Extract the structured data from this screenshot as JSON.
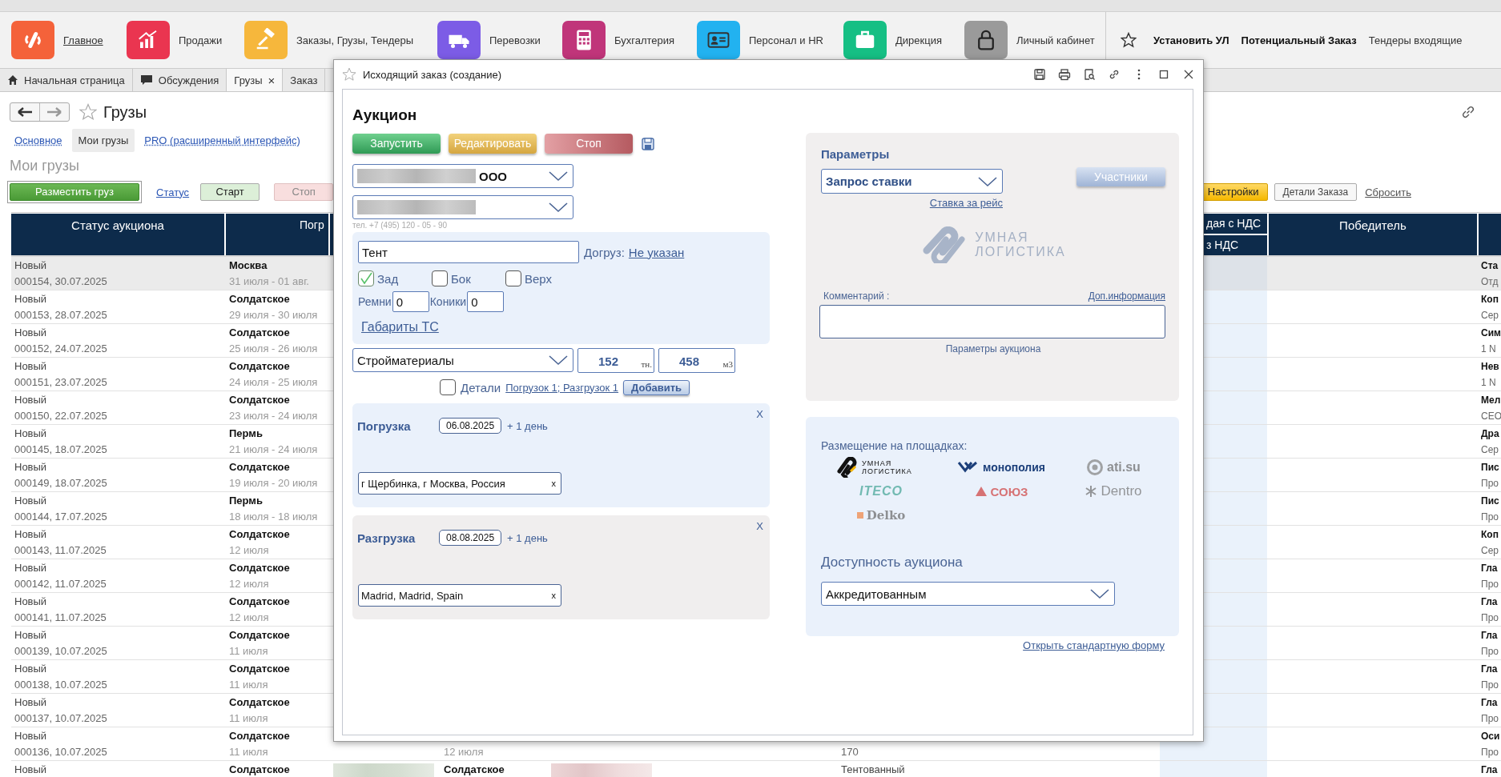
{
  "nav": {
    "items": [
      {
        "label": "Главное",
        "color": "#f4623a",
        "selected": true
      },
      {
        "label": "Продажи",
        "color": "#ea3550",
        "selected": false
      },
      {
        "label": "Заказы, Грузы, Тендеры",
        "color": "#f6b73c",
        "selected": false
      },
      {
        "label": "Перевозки",
        "color": "#7c5ce6",
        "selected": false
      },
      {
        "label": "Бухгалтерия",
        "color": "#c0357a",
        "selected": false
      },
      {
        "label": "Персонал и HR",
        "color": "#22b2f0",
        "selected": false
      },
      {
        "label": "Дирекция",
        "color": "#16bf84",
        "selected": false
      },
      {
        "label": "Личный кабинет",
        "color": "#9a9a9a",
        "selected": false
      }
    ],
    "links": [
      {
        "label": "Установить УЛ",
        "bold": true
      },
      {
        "label": "Потенциальный Заказ",
        "bold": true
      },
      {
        "label": "Тендеры входящие",
        "bold": false
      }
    ]
  },
  "tabs": [
    {
      "label": "Начальная страница",
      "selected": false
    },
    {
      "label": "Обсуждения",
      "selected": false
    },
    {
      "label": "Грузы",
      "selected": true,
      "close": "×"
    },
    {
      "label": "Заказ",
      "selected": false
    }
  ],
  "page": {
    "title": "Грузы",
    "subtabs": [
      {
        "label": "Основное",
        "selected": false
      },
      {
        "label": "Мои грузы",
        "selected": true
      },
      {
        "label": "PRO (расширенный интерфейс)",
        "selected": false
      }
    ],
    "heading": "Мои грузы",
    "toolbar": [
      {
        "kind": "primary",
        "label": "Разместить груз"
      },
      {
        "kind": "link",
        "label": "Статус"
      },
      {
        "kind": "start",
        "label": "Старт"
      },
      {
        "kind": "stop",
        "label": "Стоп"
      }
    ],
    "toolbar_right": [
      {
        "kind": "settings",
        "label": "Настройки"
      },
      {
        "kind": "plain",
        "label": "Детали Заказа"
      },
      {
        "kind": "link",
        "label": "Сбросить"
      }
    ]
  },
  "table": {
    "headers": {
      "status": "Статус аукциона",
      "loading": "Погр",
      "price": "дая с НДС",
      "price_sub": "з НДС",
      "winner": "Победитель"
    },
    "rows": [
      {
        "selected": true,
        "status": "Новый",
        "number": "000154, 30.07.2025",
        "loading": "Москва",
        "loading_dates": "31 июля - 01 авг.",
        "column_9": {
          "line_1": "Ста",
          "line_2": "Отд"
        }
      },
      {
        "selected": false,
        "status": "Новый",
        "number": "000153, 28.07.2025",
        "loading": "Солдатское",
        "loading_dates": "29 июля - 30 июля",
        "column_9": {
          "line_1": "Коп",
          "line_2": "Сер"
        }
      },
      {
        "selected": false,
        "status": "Новый",
        "number": "000152, 24.07.2025",
        "loading": "Солдатское",
        "loading_dates": "25 июля - 26 июля",
        "column_9": {
          "line_1": "Сим",
          "line_2": "1 N"
        }
      },
      {
        "selected": false,
        "status": "Новый",
        "number": "000151, 23.07.2025",
        "loading": "Солдатское",
        "loading_dates": "24 июля - 25 июля",
        "column_9": {
          "line_1": "Нев",
          "line_2": "1 N"
        }
      },
      {
        "selected": false,
        "status": "Новый",
        "number": "000150, 22.07.2025",
        "loading": "Солдатское",
        "loading_dates": "23 июля - 24 июля",
        "column_9": {
          "line_1": "Мел",
          "line_2": "CEO"
        }
      },
      {
        "selected": false,
        "status": "Новый",
        "number": "000145, 18.07.2025",
        "loading": "Пермь",
        "loading_dates": "21 июля - 24 июля",
        "column_9": {
          "line_1": "Дра",
          "line_2": "Сер"
        }
      },
      {
        "selected": false,
        "status": "Новый",
        "number": "000149, 18.07.2025",
        "loading": "Солдатское",
        "loading_dates": "19 июля - 20 июля",
        "column_9": {
          "line_1": "Пис",
          "line_2": "Про"
        }
      },
      {
        "selected": false,
        "status": "Новый",
        "number": "000144, 17.07.2025",
        "loading": "Пермь",
        "loading_dates": "18 июля - 18 июля",
        "column_9": {
          "line_1": "Пис",
          "line_2": "Про"
        }
      },
      {
        "selected": false,
        "status": "Новый",
        "number": "000143, 11.07.2025",
        "loading": "Солдатское",
        "loading_dates": "12 июля",
        "column_9": {
          "line_1": "Коп",
          "line_2": "Сер"
        }
      },
      {
        "selected": false,
        "status": "Новый",
        "number": "000142, 11.07.2025",
        "loading": "Солдатское",
        "loading_dates": "12 июля",
        "column_9": {
          "line_1": "Гла",
          "line_2": "Про"
        }
      },
      {
        "selected": false,
        "status": "Новый",
        "number": "000141, 11.07.2025",
        "loading": "Солдатское",
        "loading_dates": "12 июля",
        "column_9": {
          "line_1": "Гла",
          "line_2": "Про"
        }
      },
      {
        "selected": false,
        "status": "Новый",
        "number": "000139, 10.07.2025",
        "loading": "Солдатское",
        "loading_dates": "11 июля",
        "column_9": {
          "line_1": "Гла",
          "line_2": "Про"
        }
      },
      {
        "selected": false,
        "status": "Новый",
        "number": "000138, 10.07.2025",
        "loading": "Солдатское",
        "loading_dates": "11 июля",
        "column_9": {
          "line_1": "Гла",
          "line_2": "Про"
        }
      },
      {
        "selected": false,
        "status": "Новый",
        "number": "000137, 10.07.2025",
        "loading": "Солдатское",
        "loading_dates": "11 июля",
        "column_9": {
          "line_1": "Гла",
          "line_2": "Про"
        }
      },
      {
        "selected": false,
        "status": "Новый",
        "number": "000136, 10.07.2025",
        "loading": "Солдатское",
        "loading_dates": "11 июля",
        "unloading_dates": "12 июля",
        "column_6": {
          "line_2": "170"
        },
        "column_9": {
          "line_1": "Оси",
          "line_2": "Про"
        }
      },
      {
        "selected": false,
        "status": "Новый",
        "loading": "Солдатское",
        "redacted": true,
        "unloading": "Солдатское",
        "column_6": {
          "line_1": "Тентованный"
        },
        "column_9": {
          "line_1": "Гла"
        }
      }
    ]
  },
  "dialog": {
    "title": "Исходящий заказ (создание)",
    "heading": "Аукцион",
    "actions": [
      {
        "kind": "launch",
        "label": "Запустить"
      },
      {
        "kind": "edit",
        "label": "Редактировать"
      },
      {
        "kind": "stop",
        "label": "Стоп"
      }
    ],
    "company": {
      "value": "ООО",
      "redacted": true
    },
    "contact": {
      "redacted": true
    },
    "phone_hint": "тел. +7 (495) 120 - 05 - 90",
    "body_type": "Тент",
    "extra_load": {
      "label": "Догруз:",
      "link": "Не указан"
    },
    "loading_sides": [
      {
        "label": "Зад",
        "checked": true
      },
      {
        "label": "Бок",
        "checked": false
      },
      {
        "label": "Верх",
        "checked": false
      }
    ],
    "counters": [
      {
        "label": "Ремни",
        "value": "0"
      },
      {
        "label": "Коники",
        "value": "0"
      }
    ],
    "dimensions_link": "Габариты ТС",
    "cargo": "Стройматериалы",
    "weight": {
      "value": "152",
      "unit": "тн."
    },
    "volume": {
      "value": "458",
      "unit": "м3"
    },
    "details": {
      "checked": false,
      "label": "Детали",
      "link": "Погрузок 1; Разгрузок 1",
      "button": "Добавить"
    },
    "stops": [
      {
        "kind": "loading",
        "label": "Погрузка",
        "date": "06.08.2025",
        "extra": "+ 1 день",
        "close": "X",
        "address": "г Щербинка, г Москва, Россия",
        "clear": "x"
      },
      {
        "kind": "unloading",
        "label": "Разгрузка",
        "date": "08.08.2025",
        "extra": "+ 1 день",
        "close": "X",
        "address": "Madrid, Madrid, Spain",
        "clear": "x"
      }
    ],
    "parameters": {
      "title": "Параметры",
      "rate_type": "Запрос ставки",
      "participants_button": "Участники",
      "rate_link": "Ставка за рейс",
      "logo_lines": [
        "УМНАЯ",
        "ЛОГИСТИКА"
      ],
      "comment_label": "Комментарий :",
      "info_link": "Доп.информация",
      "footer": "Параметры аукциона"
    },
    "platforms": {
      "title": "Размещение на площадках:",
      "items": [
        {
          "label": "УМНАЯ ЛОГИСТИКА",
          "active": true
        },
        {
          "label": "монополия",
          "active": true
        },
        {
          "label": "ati.su",
          "active": false
        },
        {
          "label": "ITECO",
          "active": false
        },
        {
          "label": "СОЮЗ",
          "active": false
        },
        {
          "label": "Dentro",
          "active": false
        },
        {
          "label": "Delko",
          "active": false
        }
      ]
    },
    "availability": {
      "title": "Доступность аукциона",
      "value": "Аккредитованным"
    },
    "open_form_link": "Открыть стандартную форму"
  }
}
